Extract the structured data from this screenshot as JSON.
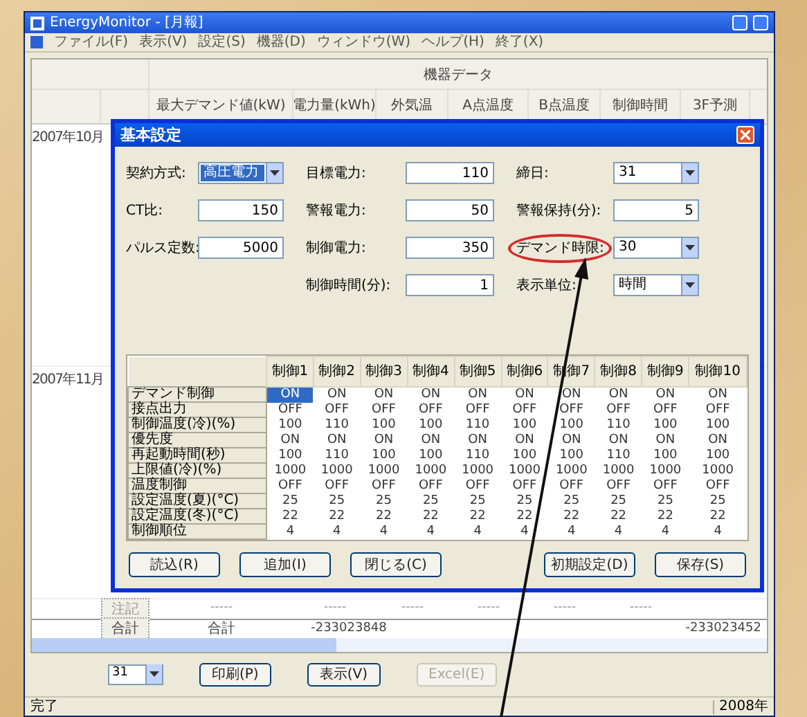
{
  "window": {
    "title": "EnergyMonitor - [月報]"
  },
  "menu": [
    "ファイル(F)",
    "表示(V)",
    "設定(S)",
    "機器(D)",
    "ウィンドウ(W)",
    "ヘルプ(H)",
    "終了(X)"
  ],
  "table": {
    "group_header": "機器データ",
    "columns": [
      "最大デマンド値(kW)",
      "電力量(kWh)",
      "外気温",
      "A点温度",
      "B点温度",
      "制御時間",
      "3F予測"
    ],
    "rows": [
      {
        "label": "2007年10月"
      },
      {
        "label": "2007年11月"
      }
    ],
    "note_row": {
      "label": "注記",
      "cells": [
        "-----",
        "-----",
        "-----",
        "-----",
        "-----",
        "-----"
      ]
    },
    "total_row": {
      "label": "合計",
      "caption": "合計",
      "value": "-233023848",
      "total": "-233023452"
    }
  },
  "dialog": {
    "title": "基本設定",
    "field_columns": [
      [
        {
          "label": "契約方式:",
          "kind": "select",
          "value": "高圧電力",
          "highlighted": true,
          "circled": false
        },
        {
          "label": "CT比:",
          "kind": "input",
          "value": "150",
          "highlighted": false,
          "circled": false
        },
        {
          "label": "パルス定数:",
          "kind": "input",
          "value": "5000",
          "highlighted": false,
          "circled": false
        }
      ],
      [
        {
          "label": "目標電力:",
          "kind": "input",
          "value": "110",
          "highlighted": false,
          "circled": false
        },
        {
          "label": "警報電力:",
          "kind": "input",
          "value": "50",
          "highlighted": false,
          "circled": false
        },
        {
          "label": "制御電力:",
          "kind": "input",
          "value": "350",
          "highlighted": false,
          "circled": false
        },
        {
          "label": "制御時間(分):",
          "kind": "input",
          "value": "1",
          "highlighted": false,
          "circled": false
        }
      ],
      [
        {
          "label": "締日:",
          "kind": "select",
          "value": "31",
          "highlighted": false,
          "circled": false
        },
        {
          "label": "警報保持(分):",
          "kind": "input",
          "value": "5",
          "highlighted": false,
          "circled": false
        },
        {
          "label": "デマンド時限:",
          "kind": "select",
          "value": "30",
          "highlighted": false,
          "circled": true
        },
        {
          "label": "表示単位:",
          "kind": "select",
          "value": "時間",
          "highlighted": false,
          "circled": false
        }
      ]
    ],
    "grid": {
      "columns": [
        "制御1",
        "制御2",
        "制御3",
        "制御4",
        "制御5",
        "制御6",
        "制御7",
        "制御8",
        "制御9",
        "制御10"
      ],
      "rows": [
        {
          "label": "デマンド制御",
          "cells": [
            {
              "text": "ON",
              "selected": true
            },
            {
              "text": "ON",
              "selected": false
            },
            {
              "text": "ON",
              "selected": false
            },
            {
              "text": "ON",
              "selected": false
            },
            {
              "text": "ON",
              "selected": false
            },
            {
              "text": "ON",
              "selected": false
            },
            {
              "text": "ON",
              "selected": false
            },
            {
              "text": "ON",
              "selected": false
            },
            {
              "text": "ON",
              "selected": false
            },
            {
              "text": "ON",
              "selected": false
            }
          ]
        },
        {
          "label": "接点出力",
          "cells": [
            {
              "text": "OFF",
              "selected": false
            },
            {
              "text": "OFF",
              "selected": false
            },
            {
              "text": "OFF",
              "selected": false
            },
            {
              "text": "OFF",
              "selected": false
            },
            {
              "text": "OFF",
              "selected": false
            },
            {
              "text": "OFF",
              "selected": false
            },
            {
              "text": "OFF",
              "selected": false
            },
            {
              "text": "OFF",
              "selected": false
            },
            {
              "text": "OFF",
              "selected": false
            },
            {
              "text": "OFF",
              "selected": false
            }
          ]
        },
        {
          "label": "制御温度(冷)(%)",
          "cells": [
            {
              "text": "100",
              "selected": false
            },
            {
              "text": "110",
              "selected": false
            },
            {
              "text": "100",
              "selected": false
            },
            {
              "text": "100",
              "selected": false
            },
            {
              "text": "110",
              "selected": false
            },
            {
              "text": "100",
              "selected": false
            },
            {
              "text": "100",
              "selected": false
            },
            {
              "text": "110",
              "selected": false
            },
            {
              "text": "100",
              "selected": false
            },
            {
              "text": "100",
              "selected": false
            }
          ]
        },
        {
          "label": "優先度",
          "cells": [
            {
              "text": "ON",
              "selected": false
            },
            {
              "text": "ON",
              "selected": false
            },
            {
              "text": "ON",
              "selected": false
            },
            {
              "text": "ON",
              "selected": false
            },
            {
              "text": "ON",
              "selected": false
            },
            {
              "text": "ON",
              "selected": false
            },
            {
              "text": "ON",
              "selected": false
            },
            {
              "text": "ON",
              "selected": false
            },
            {
              "text": "ON",
              "selected": false
            },
            {
              "text": "ON",
              "selected": false
            }
          ]
        },
        {
          "label": "再起動時間(秒)",
          "cells": [
            {
              "text": "100",
              "selected": false
            },
            {
              "text": "110",
              "selected": false
            },
            {
              "text": "100",
              "selected": false
            },
            {
              "text": "100",
              "selected": false
            },
            {
              "text": "110",
              "selected": false
            },
            {
              "text": "100",
              "selected": false
            },
            {
              "text": "100",
              "selected": false
            },
            {
              "text": "110",
              "selected": false
            },
            {
              "text": "100",
              "selected": false
            },
            {
              "text": "100",
              "selected": false
            }
          ]
        },
        {
          "label": "上限値(冷)(%)",
          "cells": [
            {
              "text": "1000",
              "selected": false
            },
            {
              "text": "1000",
              "selected": false
            },
            {
              "text": "1000",
              "selected": false
            },
            {
              "text": "1000",
              "selected": false
            },
            {
              "text": "1000",
              "selected": false
            },
            {
              "text": "1000",
              "selected": false
            },
            {
              "text": "1000",
              "selected": false
            },
            {
              "text": "1000",
              "selected": false
            },
            {
              "text": "1000",
              "selected": false
            },
            {
              "text": "1000",
              "selected": false
            }
          ]
        },
        {
          "label": "温度制御",
          "cells": [
            {
              "text": "OFF",
              "selected": false
            },
            {
              "text": "OFF",
              "selected": false
            },
            {
              "text": "OFF",
              "selected": false
            },
            {
              "text": "OFF",
              "selected": false
            },
            {
              "text": "OFF",
              "selected": false
            },
            {
              "text": "OFF",
              "selected": false
            },
            {
              "text": "OFF",
              "selected": false
            },
            {
              "text": "OFF",
              "selected": false
            },
            {
              "text": "OFF",
              "selected": false
            },
            {
              "text": "OFF",
              "selected": false
            }
          ]
        },
        {
          "label": "設定温度(夏)(°C)",
          "cells": [
            {
              "text": "25",
              "selected": false
            },
            {
              "text": "25",
              "selected": false
            },
            {
              "text": "25",
              "selected": false
            },
            {
              "text": "25",
              "selected": false
            },
            {
              "text": "25",
              "selected": false
            },
            {
              "text": "25",
              "selected": false
            },
            {
              "text": "25",
              "selected": false
            },
            {
              "text": "25",
              "selected": false
            },
            {
              "text": "25",
              "selected": false
            },
            {
              "text": "25",
              "selected": false
            }
          ]
        },
        {
          "label": "設定温度(冬)(°C)",
          "cells": [
            {
              "text": "22",
              "selected": false
            },
            {
              "text": "22",
              "selected": false
            },
            {
              "text": "22",
              "selected": false
            },
            {
              "text": "22",
              "selected": false
            },
            {
              "text": "22",
              "selected": false
            },
            {
              "text": "22",
              "selected": false
            },
            {
              "text": "22",
              "selected": false
            },
            {
              "text": "22",
              "selected": false
            },
            {
              "text": "22",
              "selected": false
            },
            {
              "text": "22",
              "selected": false
            }
          ]
        },
        {
          "label": "制御順位",
          "cells": [
            {
              "text": "4",
              "selected": false
            },
            {
              "text": "4",
              "selected": false
            },
            {
              "text": "4",
              "selected": false
            },
            {
              "text": "4",
              "selected": false
            },
            {
              "text": "4",
              "selected": false
            },
            {
              "text": "4",
              "selected": false
            },
            {
              "text": "4",
              "selected": false
            },
            {
              "text": "4",
              "selected": false
            },
            {
              "text": "4",
              "selected": false
            },
            {
              "text": "4",
              "selected": false
            }
          ]
        }
      ]
    },
    "left_buttons": [
      "読込(R)",
      "追加(I)",
      "閉じる(C)"
    ],
    "right_buttons": [
      "初期設定(D)",
      "保存(S)"
    ]
  },
  "bottom": {
    "select": "31",
    "buttons": [
      {
        "label": "印刷(P)",
        "disabled": false
      },
      {
        "label": "表示(V)",
        "disabled": false
      },
      {
        "label": "Excel(E)",
        "disabled": true
      }
    ]
  },
  "status_bar": {
    "left": "完了",
    "right": "2008年"
  }
}
